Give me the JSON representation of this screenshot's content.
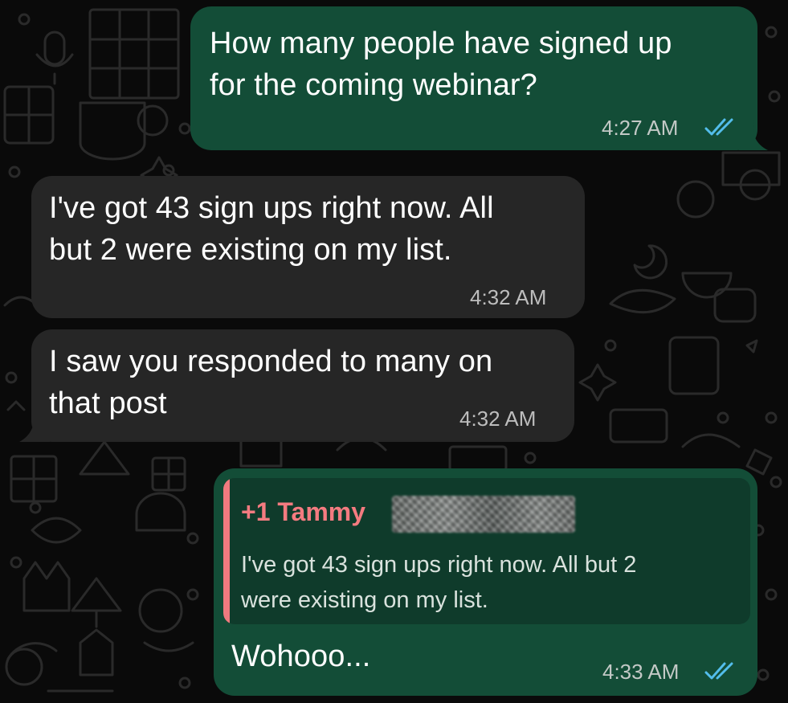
{
  "messages": [
    {
      "direction": "outgoing",
      "text": "How many people have signed up\nfor the coming webinar?",
      "time": "4:27 AM",
      "status": "read-double-check"
    },
    {
      "direction": "incoming",
      "text": "I've got 43 sign ups right now. All\nbut 2 were existing on my list.",
      "time": "4:32 AM"
    },
    {
      "direction": "incoming",
      "text": "I saw you responded to many on\nthat post",
      "time": "4:32 AM"
    },
    {
      "direction": "outgoing",
      "reply_to": {
        "author": "+1 Tammy",
        "author_redacted": true,
        "text": "I've got 43 sign ups right now. All but 2\nwere existing on my list."
      },
      "text": "Wohooo...",
      "time": "4:33 AM",
      "status": "read-double-check"
    }
  ],
  "colors": {
    "outgoing_bubble": "#134d37",
    "incoming_bubble": "#262626",
    "quote_background": "#0f3b2b",
    "quote_accent": "#f07a7f",
    "read_ticks": "#53bdeb",
    "background": "#0a0a0a"
  },
  "icons": {
    "read_status": "double-check-icon",
    "wallpaper": "doodle-pattern"
  }
}
